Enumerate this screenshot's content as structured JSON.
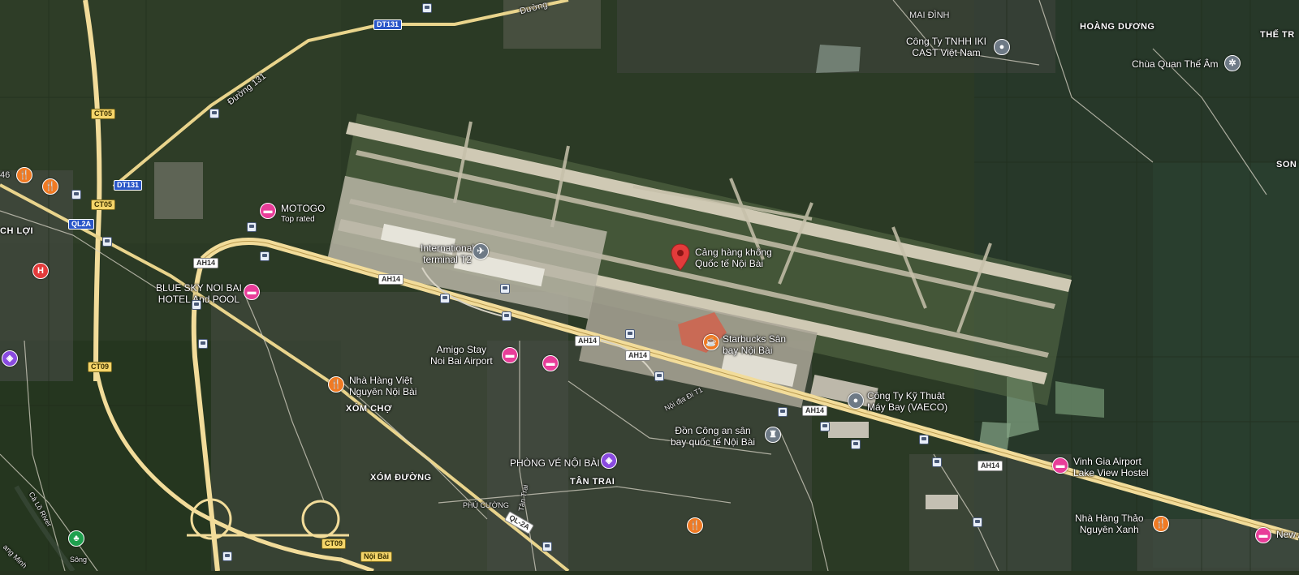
{
  "map": {
    "main_place": {
      "name_line1": "Cảng hàng không",
      "name_line2": "Quốc tế Nội Bài"
    },
    "pois": {
      "international_terminal": {
        "line1": "International",
        "line2": "terminal T2",
        "icon": "airport-icon"
      },
      "starbucks": {
        "line1": "Starbucks Sân",
        "line2": "bay Nội Bài",
        "icon": "cafe-icon"
      },
      "vaeco": {
        "line1": "Công Ty Kỹ Thuật",
        "line2": "Máy Bay (VAECO)",
        "icon": "building-icon"
      },
      "don_cong_an": {
        "line1": "Đồn Công an sân",
        "line2": "bay quốc tế Nội Bài",
        "icon": "police-icon"
      },
      "phong_ve": {
        "line1": "PHÒNG VÉ NỘI BÀI",
        "icon": "shopping-icon"
      },
      "amigo": {
        "line1": "Amigo Stay",
        "line2": "Noi Bai Airport",
        "icon": "hotel-icon"
      },
      "blue_sky": {
        "line1": "BLUE SKY NOI BAI",
        "line2": "HOTEL And POOL",
        "icon": "hotel-icon"
      },
      "motogo": {
        "line1": "MOTOGO",
        "line2": "Top rated",
        "icon": "hotel-icon"
      },
      "nha_hang_viet": {
        "line1": "Nhà Hàng Việt",
        "line2": "Nguyên Nội Bài",
        "icon": "restaurant-icon"
      },
      "vinh_gia": {
        "line1": "Vinh Gia Airport",
        "line2": "Lake View Hostel",
        "icon": "hotel-icon"
      },
      "nha_hang_thao": {
        "line1": "Nhà Hàng Thảo",
        "line2": "Nguyên Xanh",
        "icon": "restaurant-icon"
      },
      "iki_cast": {
        "line1": "Công Ty TNHH IKI",
        "line2": "CAST Việt Nam",
        "icon": "building-icon"
      },
      "chua_quan": {
        "line1": "Chùa Quan Thế Âm",
        "icon": "temple-icon"
      },
      "new_partial": {
        "line1": "New A"
      }
    },
    "areas": {
      "mai_dinh": "MAI ĐÌNH",
      "hoang_duong": "HOÀNG DƯƠNG",
      "the_tr": "THẾ TR",
      "son": "SON",
      "ch_loi": "CH LỢI",
      "xom_cho": "XÓM CHỢ",
      "xom_duong": "XÓM ĐƯỜNG",
      "tan_trai": "TÂN TRAI",
      "phu_cuong": "PHÚ CƯỜNG"
    },
    "roads": {
      "duong_131": "Đường 131",
      "duong_top": "Đường",
      "noi_dia": "Nội địa Đi T1",
      "tan_trai_road": "Tân Trai",
      "ca_lo_river": "Cà Lồ River",
      "sang": "Sông",
      "tang_minh": "ang Minh",
      "num_46": "46"
    },
    "shields": {
      "dt131_top": "DT131",
      "dt131_left": "DT131",
      "ct05_a": "CT05",
      "ct05_b": "CT05",
      "ql2a": "QL2A",
      "ct09_a": "CT09",
      "ct09_b": "CT09",
      "ah14_a": "AH14",
      "ah14_b": "AH14",
      "ah14_c": "AH14",
      "ah14_d": "AH14",
      "ah14_e": "AH14",
      "ah14_f": "AH14",
      "ql2a_road": "QL-2A",
      "noi_bai_shield": "Nội Bài"
    },
    "colors": {
      "main_pin": "#e33b3b",
      "hotel": "#e83d99",
      "food": "#f07a23",
      "place": "#8a4be0",
      "highway": "#f2dc9a"
    }
  }
}
